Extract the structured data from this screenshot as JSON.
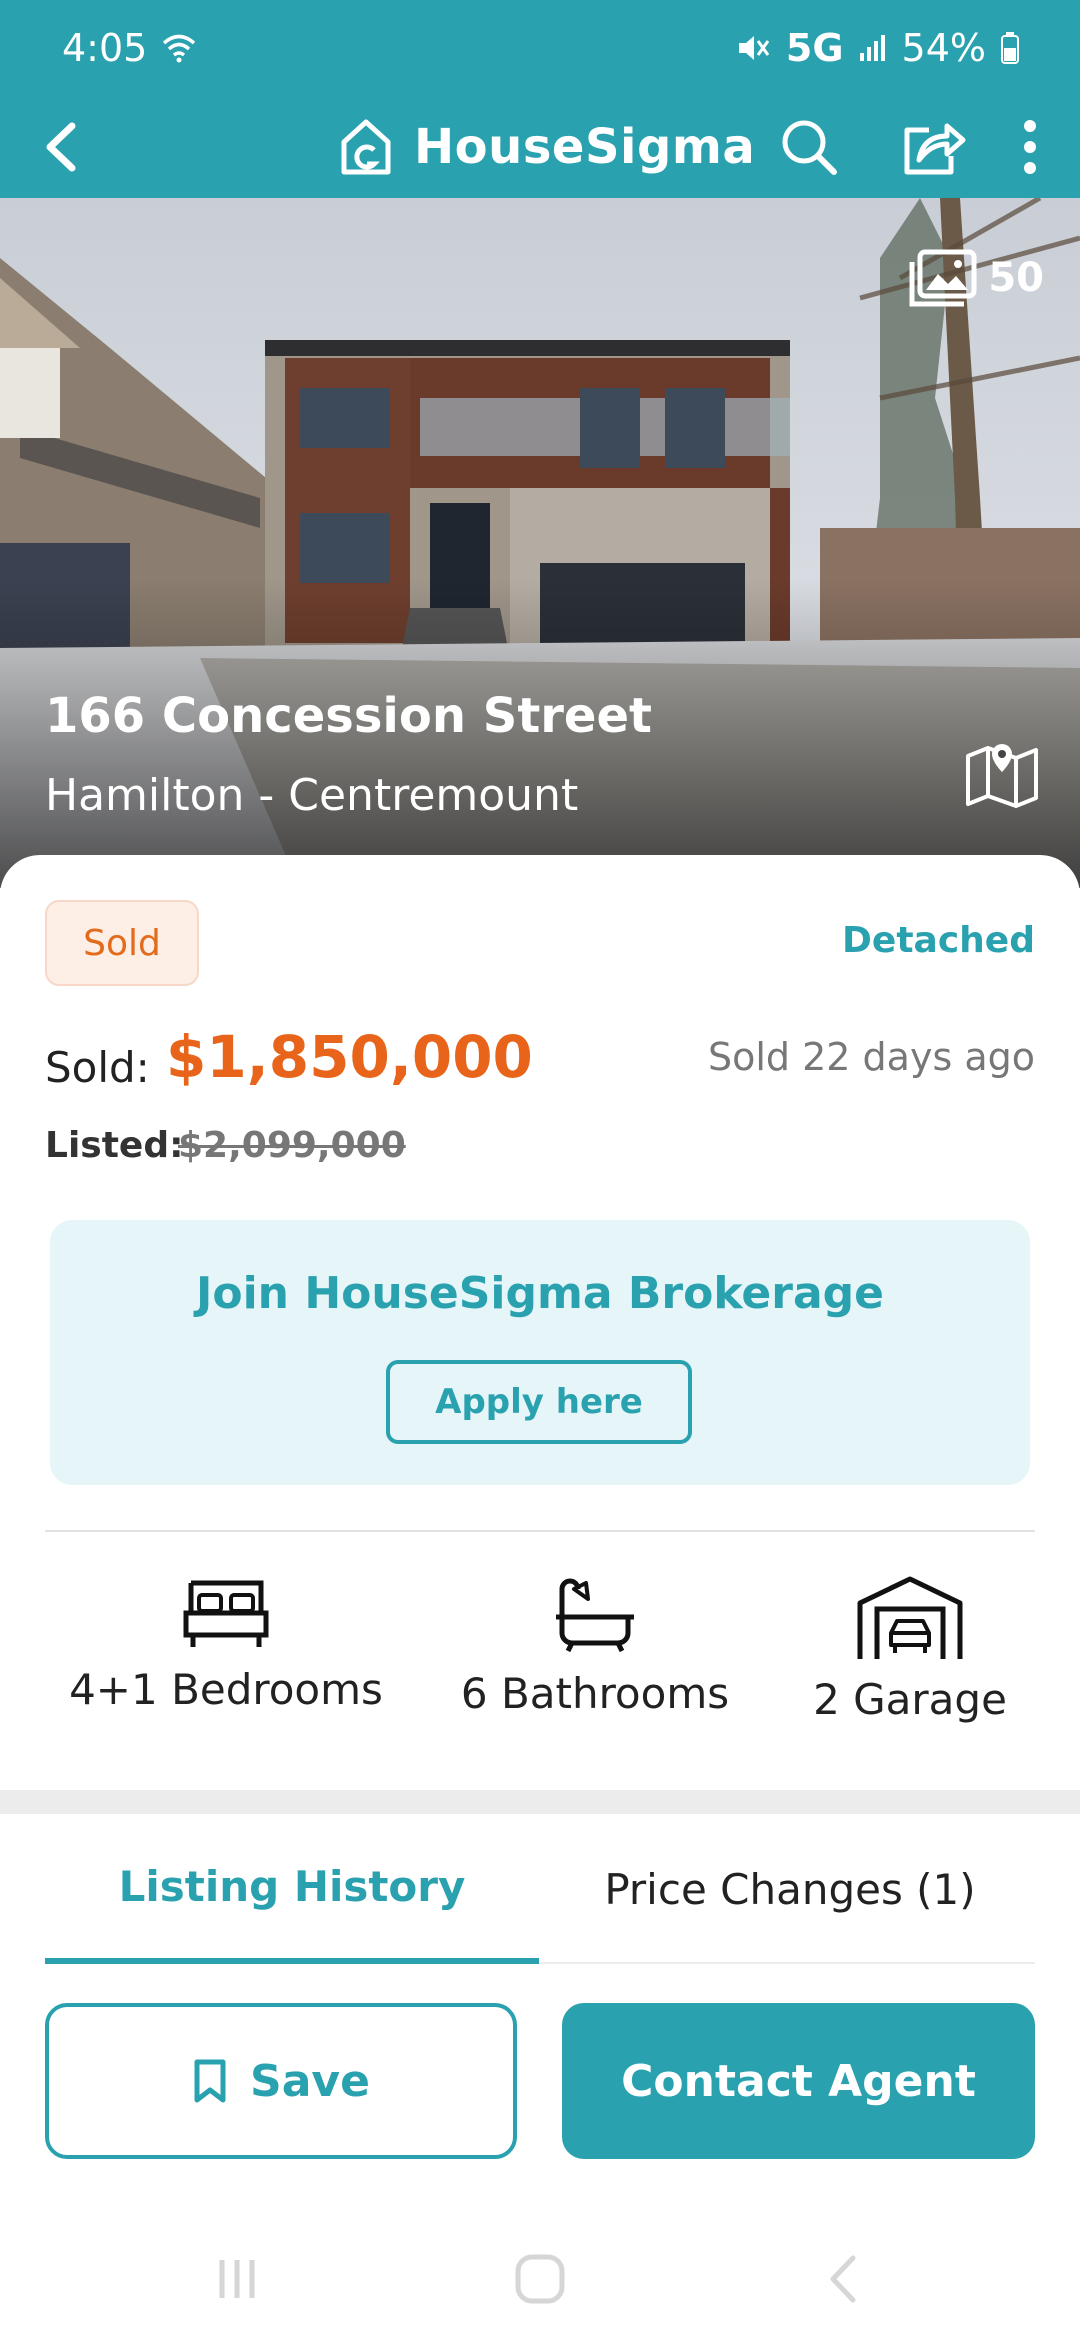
{
  "status_bar": {
    "time": "4:05",
    "network": "5G",
    "battery": "54%"
  },
  "app_bar": {
    "brand": "HouseSigma"
  },
  "hero": {
    "photo_count": "50",
    "address": "166 Concession Street",
    "area": "Hamilton - Centremount"
  },
  "listing": {
    "status_badge": "Sold",
    "property_type": "Detached",
    "sold_label": "Sold:",
    "sold_price": "$1,850,000",
    "sold_ago": "Sold 22 days ago",
    "listed_label": "Listed:",
    "listed_price": "$2,099,000"
  },
  "promo": {
    "title": "Join HouseSigma Brokerage",
    "button": "Apply here"
  },
  "features": {
    "bedrooms": "4+1 Bedrooms",
    "bathrooms": "6 Bathrooms",
    "garage": "2 Garage"
  },
  "tabs": {
    "active": "Listing History",
    "other": "Price Changes (1)"
  },
  "actions": {
    "save": "Save",
    "contact": "Contact Agent"
  },
  "colors": {
    "accent": "#2aa1af",
    "sold": "#e8641a"
  }
}
